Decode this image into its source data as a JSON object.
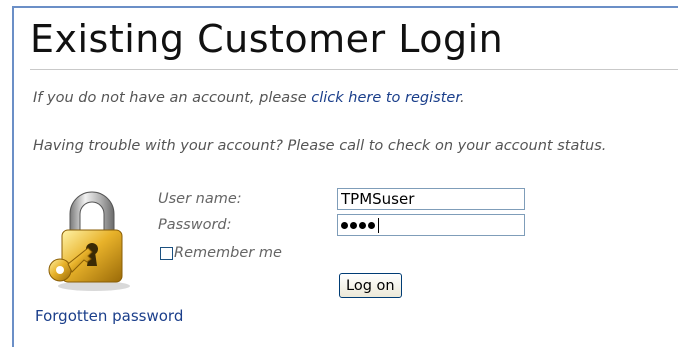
{
  "page": {
    "title": "Existing Customer Login"
  },
  "info": {
    "register_prefix": "If you do not have an account, please ",
    "register_link": "click here to register",
    "register_suffix": ".",
    "trouble_text": "Having trouble with your account? Please call to check on your account status."
  },
  "form": {
    "username_label": "User name:",
    "username_value": "TPMSuser",
    "password_label": "Password:",
    "password_masked_length": 4,
    "remember_label": "Remember me",
    "remember_checked": false,
    "logon_label": "Log on"
  },
  "forgot_password": "Forgotten password",
  "icons": {
    "lock": "padlock-with-key-icon"
  },
  "colors": {
    "link": "#1b3f8b",
    "frame_border": "#6b8fc7",
    "lock_gold": "#e8b22a"
  }
}
